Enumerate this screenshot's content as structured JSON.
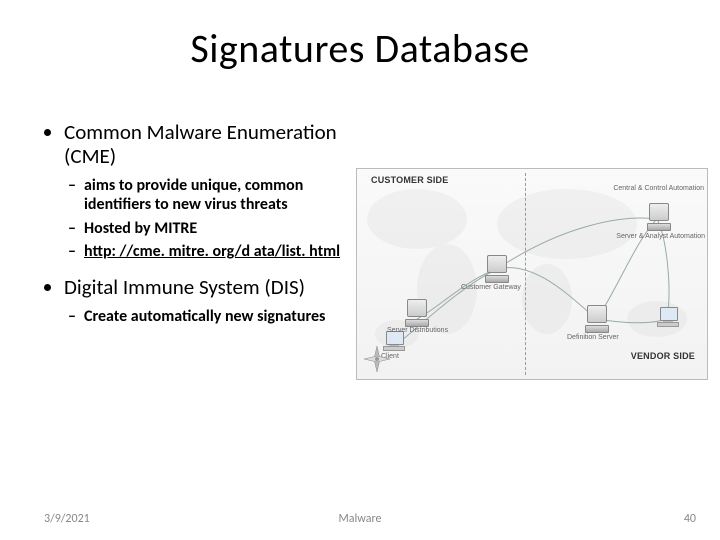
{
  "title": "Signatures Database",
  "bullets": {
    "b1": "Common Malware Enumeration (CME)",
    "b1a": "aims to provide unique, common identifiers to new virus threats",
    "b1b": "Hosted by MITRE",
    "b1c": "http: //cme. mitre. org/d ata/list. html",
    "b2": "Digital Immune System (DIS)",
    "b2a": "Create automatically new signatures"
  },
  "diagram": {
    "customer_side": "CUSTOMER SIDE",
    "vendor_side": "VENDOR SIDE",
    "client": "Client",
    "customer_gateway": "Customer Gateway",
    "server_distributions": "Server Distributions",
    "definition_server": "Definition Server",
    "central": "Central & Control Automation",
    "analyst": "Server & Analyst Automation"
  },
  "footer": {
    "date": "3/9/2021",
    "center": "Malware",
    "page": "40"
  }
}
